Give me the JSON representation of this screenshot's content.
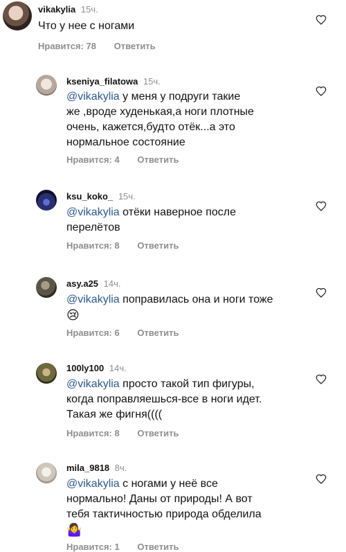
{
  "comments": [
    {
      "username": "vikakylia",
      "time": "15ч.",
      "text": "Что у нее с ногами",
      "likes": "Нравится: 78",
      "reply": "Ответить"
    },
    {
      "username": "kseniya_filatowa",
      "time": "15ч.",
      "mention": "@vikakylia",
      "line1": " у меня у подруги такие",
      "line2": "же ,вроде худенькая,а ноги плотные",
      "line3": "очень, кажется,будто отёк...а это",
      "line4": "нормальное состояние",
      "likes": "Нравится: 4",
      "reply": "Ответить"
    },
    {
      "username": "ksu_koko_",
      "time": "15ч.",
      "mention": "@vikakylia",
      "line1": " отёки наверное после",
      "line2": "перелётов",
      "likes": "Нравится: 8",
      "reply": "Ответить"
    },
    {
      "username": "asy.a25",
      "time": "14ч.",
      "mention": "@vikakylia",
      "line1": " поправилась она и ноги тоже",
      "emoji": "😢",
      "likes": "Нравится: 6",
      "reply": "Ответить"
    },
    {
      "username": "100ly100",
      "time": "14ч.",
      "mention": "@vikakylia",
      "line1": " просто такой тип фигуры,",
      "line2": "когда поправляешься-все в ноги идет.",
      "line3": "Такая же фигня((((",
      "likes": "Нравится: 8",
      "reply": "Ответить"
    },
    {
      "username": "mila_9818",
      "time": "8ч.",
      "mention": "@vikakylia",
      "line1": " с ногами у неё все",
      "line2": "нормально! Даны от природы! А вот",
      "line3": "тебя тактичностью природа обделила",
      "emoji": "🤷‍♀️",
      "likes": "Нравится: 1",
      "reply": "Ответить"
    }
  ],
  "colors": {
    "mention": "#2a5891",
    "meta": "#8e8e8e",
    "text": "#111111"
  },
  "icons": {
    "like": "heart-outline-icon"
  }
}
